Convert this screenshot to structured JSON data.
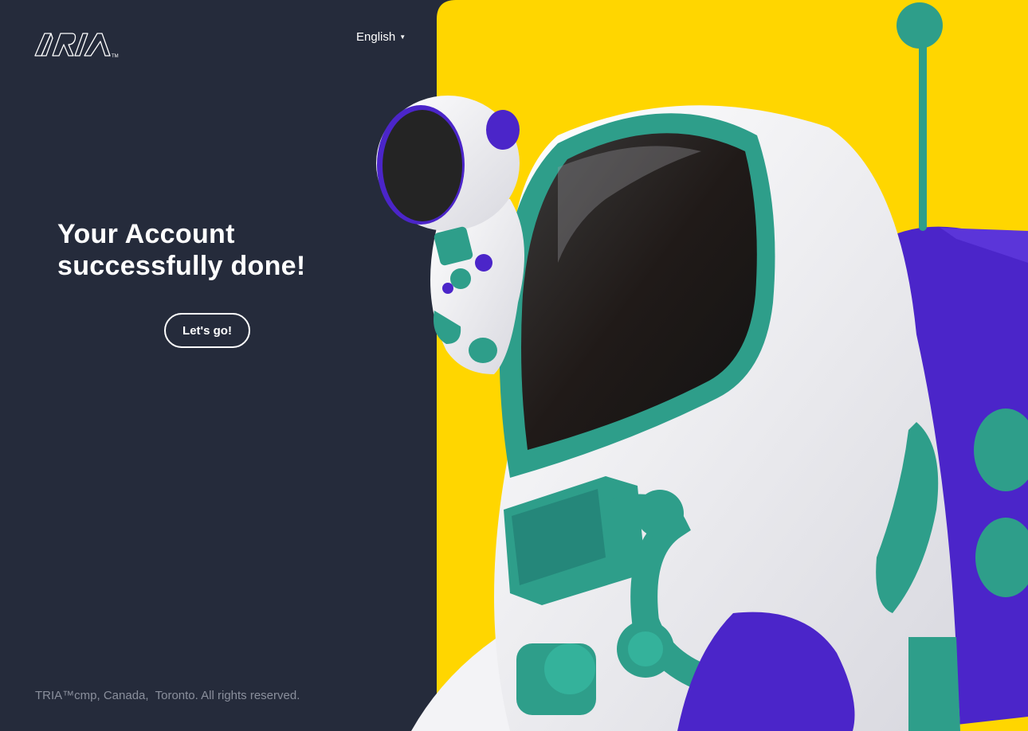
{
  "brand": {
    "logo_text": "TRIA",
    "trademark": "TM"
  },
  "header": {
    "language": "English"
  },
  "main": {
    "headline_line1": "Your Account",
    "headline_line2": "successfully done!",
    "cta_label": "Let's go!"
  },
  "footer": {
    "copyright": "TRIA™cmp, Canada,  Toronto. All rights reserved."
  },
  "colors": {
    "panel_bg": "#252b3b",
    "accent_yellow": "#ffd600",
    "suit_teal": "#2e9e8a",
    "purple": "#4b25c9"
  },
  "illustration": {
    "icon": "astronaut-illustration"
  }
}
